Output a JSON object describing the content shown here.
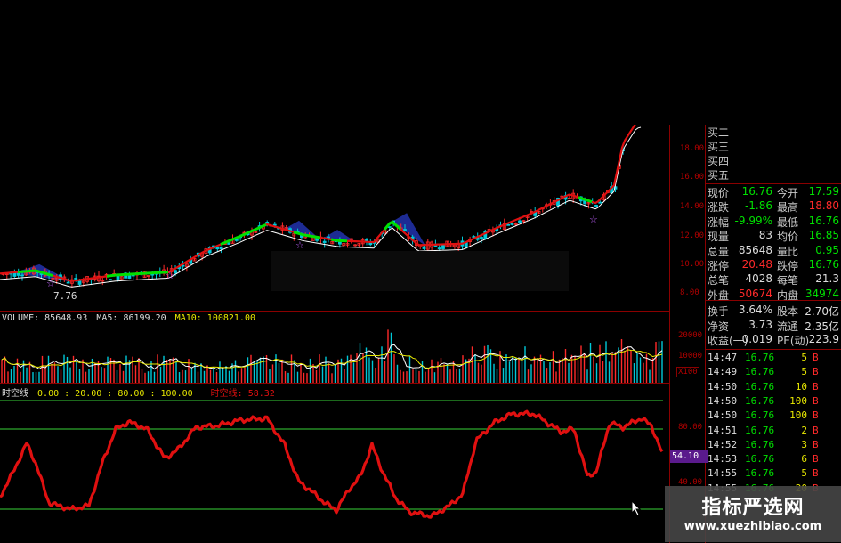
{
  "colors": {
    "up": "#ff2a2a",
    "down": "#00e000",
    "label": "#c8c8c8",
    "value_green": "#00e000",
    "value_yellow": "#e8e800",
    "axis": "#8b0000",
    "oscillator": "#e01010",
    "level_line": "#2ea82e"
  },
  "main_chart": {
    "low_marker": "7.76",
    "price_axis": [
      "18.00",
      "16.00",
      "14.00",
      "12.00",
      "10.00",
      "8.00"
    ]
  },
  "volume_panel": {
    "legend": {
      "volume": "VOLUME: 85648.93",
      "ma5": "MA5: 86199.20",
      "ma10": "MA10: 100821.00"
    },
    "axis": [
      "20000",
      "10000",
      "X100"
    ]
  },
  "oscillator_panel": {
    "title": "时空线",
    "params": "0.00 : 20.00 : 80.00 : 100.00",
    "value_label": "时空线: 58.32",
    "current_tag": "54.10",
    "axis": [
      "80.00",
      "40.00"
    ]
  },
  "quote_panel": {
    "bid_levels": [
      "买二",
      "买三",
      "买四",
      "买五"
    ],
    "rows": [
      {
        "l1": "现价",
        "v1": "16.76",
        "c1": "down",
        "l2": "今开",
        "v2": "17.59",
        "c2": "down"
      },
      {
        "l1": "涨跌",
        "v1": "-1.86",
        "c1": "down",
        "l2": "最高",
        "v2": "18.80",
        "c2": "up"
      },
      {
        "l1": "涨幅",
        "v1": "-9.99%",
        "c1": "down",
        "l2": "最低",
        "v2": "16.76",
        "c2": "down"
      },
      {
        "l1": "现量",
        "v1": "83",
        "c1": "plain",
        "l2": "均价",
        "v2": "16.85",
        "c2": "down"
      },
      {
        "l1": "总量",
        "v1": "85648",
        "c1": "plain",
        "l2": "量比",
        "v2": "0.95",
        "c2": "down"
      },
      {
        "l1": "涨停",
        "v1": "20.48",
        "c1": "up",
        "l2": "跌停",
        "v2": "16.76",
        "c2": "down"
      },
      {
        "l1": "总笔",
        "v1": "4028",
        "c1": "plain",
        "l2": "每笔",
        "v2": "21.3",
        "c2": "plain"
      },
      {
        "l1": "外盘",
        "v1": "50674",
        "c1": "up",
        "l2": "内盘",
        "v2": "34974",
        "c2": "down"
      },
      {
        "l1": "换手",
        "v1": "3.64%",
        "c1": "plain",
        "l2": "股本",
        "v2": "2.70亿",
        "c2": "plain"
      },
      {
        "l1": "净资",
        "v1": "3.73",
        "c1": "plain",
        "l2": "流通",
        "v2": "2.35亿",
        "c2": "plain"
      },
      {
        "l1": "收益(一)",
        "v1": "0.019",
        "c1": "plain",
        "l2": "PE(动)",
        "v2": "223.9",
        "c2": "plain"
      }
    ],
    "ticks": [
      {
        "time": "14:47",
        "price": "16.76",
        "vol": "5",
        "side": "B"
      },
      {
        "time": "14:49",
        "price": "16.76",
        "vol": "5",
        "side": "B"
      },
      {
        "time": "14:50",
        "price": "16.76",
        "vol": "10",
        "side": "B"
      },
      {
        "time": "14:50",
        "price": "16.76",
        "vol": "100",
        "side": "B"
      },
      {
        "time": "14:50",
        "price": "16.76",
        "vol": "100",
        "side": "B"
      },
      {
        "time": "14:51",
        "price": "16.76",
        "vol": "2",
        "side": "B"
      },
      {
        "time": "14:52",
        "price": "16.76",
        "vol": "3",
        "side": "B"
      },
      {
        "time": "14:53",
        "price": "16.76",
        "vol": "6",
        "side": "B"
      },
      {
        "time": "14:55",
        "price": "16.76",
        "vol": "5",
        "side": "B"
      },
      {
        "time": "14:55",
        "price": "16.76",
        "vol": "20",
        "side": "B"
      }
    ]
  },
  "watermark": {
    "title": "指标严选网",
    "url": "www.xuezhibiao.com"
  }
}
